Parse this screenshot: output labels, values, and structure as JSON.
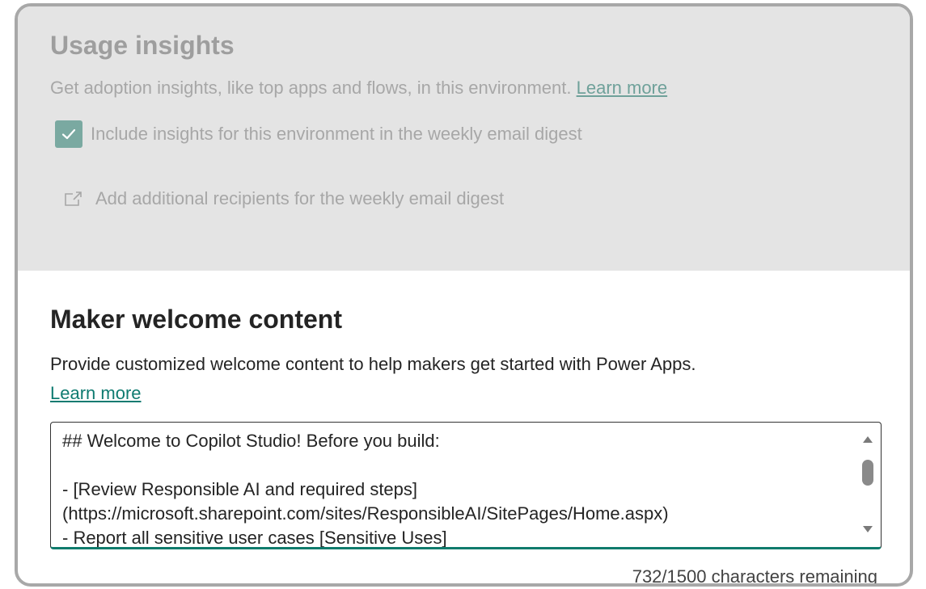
{
  "usage_insights": {
    "title": "Usage insights",
    "description": "Get adoption insights, like top apps and flows, in this environment.",
    "learn_more": "Learn more",
    "checkbox_label": "Include insights for this environment in the weekly email digest",
    "checkbox_checked": true,
    "recipients_link": "Add additional recipients for the weekly email digest"
  },
  "maker_welcome": {
    "title": "Maker welcome content",
    "description": "Provide customized welcome content to help makers get started with Power Apps.",
    "learn_more": "Learn more",
    "content": "## Welcome to Copilot Studio! Before you build:\n\n- [Review Responsible AI and required steps]\n(https://microsoft.sharepoint.com/sites/ResponsibleAI/SitePages/Home.aspx)\n- Report all sensitive user cases [Sensitive Uses]",
    "char_counter": "732/1500 characters remaining"
  },
  "colors": {
    "accent": "#0f7b71",
    "disabled_panel": "#e4e4e4"
  }
}
